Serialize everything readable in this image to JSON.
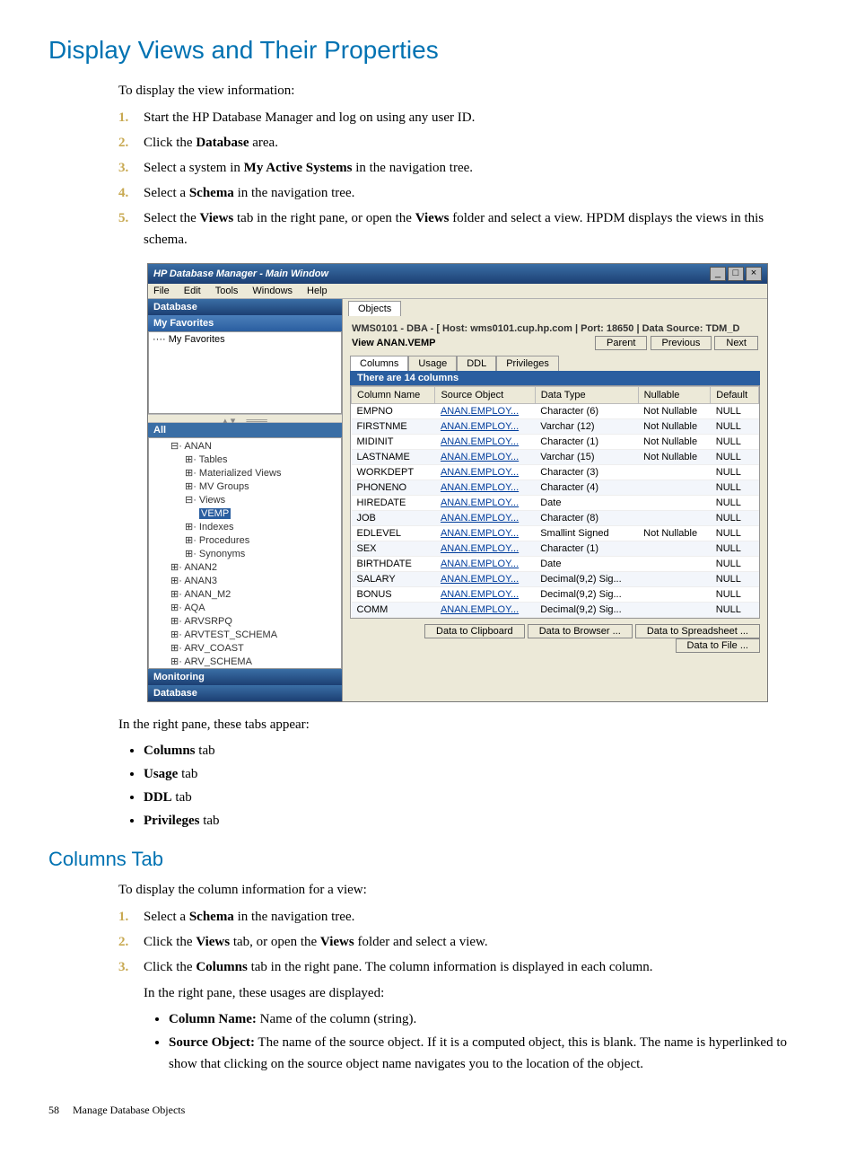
{
  "page": {
    "title": "Display Views and Their Properties",
    "intro": "To display the view information:",
    "steps": [
      "Start the HP Database Manager and log on using any user ID.",
      "Click the <b>Database</b> area.",
      "Select a system in <b>My Active Systems</b> in the navigation tree.",
      "Select a <b>Schema</b> in the navigation tree.",
      "Select the <b>Views</b> tab in the right pane, or open the <b>Views</b> folder and select a view. HPDM displays the views in this schema."
    ],
    "tabs_intro": "In the right pane, these tabs appear:",
    "tabs_list": [
      "<b>Columns</b> tab",
      "<b>Usage</b> tab",
      "<b>DDL</b> tab",
      "<b>Privileges</b> tab"
    ],
    "section2_title": "Columns Tab",
    "section2_intro": "To display the column information for a view:",
    "section2_steps": [
      "Select a <b>Schema</b> in the navigation tree.",
      "Click the <b>Views</b> tab, or open the <b>Views</b> folder and select a view.",
      "Click the <b>Columns</b> tab in the right pane. The column information is displayed in each column."
    ],
    "usages_intro": "In the right pane, these usages are displayed:",
    "usages": [
      "<b>Column Name:</b> Name of the column (string).",
      "<b>Source Object:</b> The name of the source object. If it is a computed object, this is blank. The name is hyperlinked to show that clicking on the source object name navigates you to the location of the object."
    ],
    "footer_page_number": "58",
    "footer_chapter": "Manage Database Objects"
  },
  "window": {
    "title": "HP Database Manager - Main Window",
    "menus": [
      "File",
      "Edit",
      "Tools",
      "Windows",
      "Help"
    ],
    "left": {
      "database_hdr": "Database",
      "fav_hdr": "My Favorites",
      "fav_item": "My Favorites",
      "all_hdr": "All",
      "monitoring_hdr": "Monitoring",
      "database2_hdr": "Database",
      "tree": [
        {
          "indent": 0,
          "label": "ANAN",
          "prefix": "⊟"
        },
        {
          "indent": 1,
          "label": "Tables",
          "prefix": "⊞"
        },
        {
          "indent": 1,
          "label": "Materialized Views",
          "prefix": "⊞"
        },
        {
          "indent": 1,
          "label": "MV Groups",
          "prefix": "⊞"
        },
        {
          "indent": 1,
          "label": "Views",
          "prefix": "⊟"
        },
        {
          "indent": 2,
          "label": "VEMP",
          "prefix": "",
          "selected": true
        },
        {
          "indent": 1,
          "label": "Indexes",
          "prefix": "⊞"
        },
        {
          "indent": 1,
          "label": "Procedures",
          "prefix": "⊞"
        },
        {
          "indent": 1,
          "label": "Synonyms",
          "prefix": "⊞"
        },
        {
          "indent": 0,
          "label": "ANAN2",
          "prefix": "⊞"
        },
        {
          "indent": 0,
          "label": "ANAN3",
          "prefix": "⊞"
        },
        {
          "indent": 0,
          "label": "ANAN_M2",
          "prefix": "⊞"
        },
        {
          "indent": 0,
          "label": "AQA",
          "prefix": "⊞"
        },
        {
          "indent": 0,
          "label": "ARVSRPQ",
          "prefix": "⊞"
        },
        {
          "indent": 0,
          "label": "ARVTEST_SCHEMA",
          "prefix": "⊞"
        },
        {
          "indent": 0,
          "label": "ARV_COAST",
          "prefix": "⊞"
        },
        {
          "indent": 0,
          "label": "ARV_SCHEMA",
          "prefix": "⊞"
        }
      ]
    },
    "right": {
      "objects_tab": "Objects",
      "crumb": "WMS0101 - DBA - [ Host: wms0101.cup.hp.com | Port: 18650 | Data Source: TDM_D",
      "view_name": "View ANAN.VEMP",
      "nav_buttons": [
        "Parent",
        "Previous",
        "Next"
      ],
      "tabs": [
        "Columns",
        "Usage",
        "DDL",
        "Privileges"
      ],
      "count": "There are 14 columns",
      "headers": [
        "Column Name",
        "Source Object",
        "Data Type",
        "Nullable",
        "Default"
      ],
      "rows": [
        [
          "EMPNO",
          "ANAN.EMPLOY...",
          "Character (6)",
          "Not Nullable",
          "NULL"
        ],
        [
          "FIRSTNME",
          "ANAN.EMPLOY...",
          "Varchar (12)",
          "Not Nullable",
          "NULL"
        ],
        [
          "MIDINIT",
          "ANAN.EMPLOY...",
          "Character (1)",
          "Not Nullable",
          "NULL"
        ],
        [
          "LASTNAME",
          "ANAN.EMPLOY...",
          "Varchar (15)",
          "Not Nullable",
          "NULL"
        ],
        [
          "WORKDEPT",
          "ANAN.EMPLOY...",
          "Character (3)",
          "",
          "NULL"
        ],
        [
          "PHONENO",
          "ANAN.EMPLOY...",
          "Character (4)",
          "",
          "NULL"
        ],
        [
          "HIREDATE",
          "ANAN.EMPLOY...",
          "Date",
          "",
          "NULL"
        ],
        [
          "JOB",
          "ANAN.EMPLOY...",
          "Character (8)",
          "",
          "NULL"
        ],
        [
          "EDLEVEL",
          "ANAN.EMPLOY...",
          "Smallint Signed",
          "Not Nullable",
          "NULL"
        ],
        [
          "SEX",
          "ANAN.EMPLOY...",
          "Character (1)",
          "",
          "NULL"
        ],
        [
          "BIRTHDATE",
          "ANAN.EMPLOY...",
          "Date",
          "",
          "NULL"
        ],
        [
          "SALARY",
          "ANAN.EMPLOY...",
          "Decimal(9,2) Sig...",
          "",
          "NULL"
        ],
        [
          "BONUS",
          "ANAN.EMPLOY...",
          "Decimal(9,2) Sig...",
          "",
          "NULL"
        ],
        [
          "COMM",
          "ANAN.EMPLOY...",
          "Decimal(9,2) Sig...",
          "",
          "NULL"
        ]
      ],
      "footer_buttons": [
        "Data to Clipboard",
        "Data to Browser ...",
        "Data to Spreadsheet ...",
        "Data to File ..."
      ]
    }
  }
}
